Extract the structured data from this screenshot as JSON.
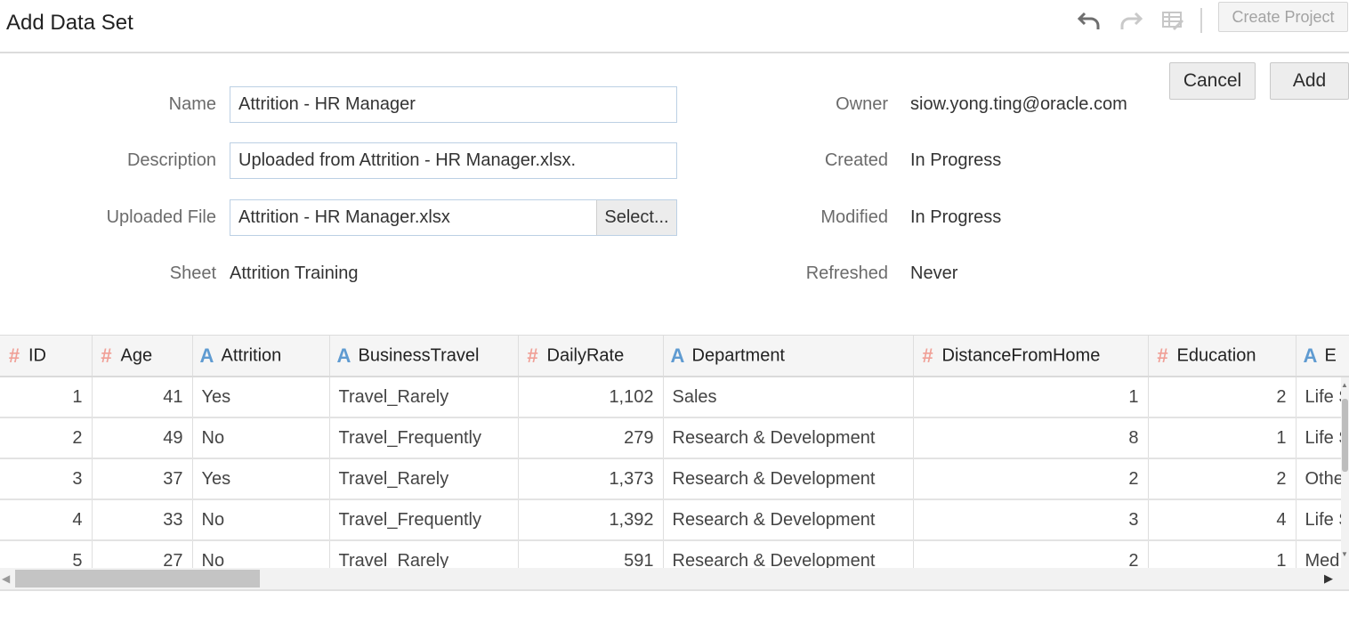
{
  "header": {
    "title": "Add Data Set",
    "create_project_label": "Create Project",
    "icons": [
      "undo-icon",
      "redo-icon",
      "data-diagram-icon"
    ]
  },
  "actions": {
    "cancel_label": "Cancel",
    "add_label": "Add"
  },
  "form": {
    "name_label": "Name",
    "name_value": "Attrition - HR Manager",
    "description_label": "Description",
    "description_value": "Uploaded from Attrition - HR Manager.xlsx.",
    "uploaded_file_label": "Uploaded File",
    "uploaded_file_value": "Attrition - HR Manager.xlsx",
    "select_label": "Select...",
    "sheet_label": "Sheet",
    "sheet_value": "Attrition Training"
  },
  "meta": {
    "owner_label": "Owner",
    "owner_value": "siow.yong.ting@oracle.com",
    "created_label": "Created",
    "created_value": "In Progress",
    "modified_label": "Modified",
    "modified_value": "In Progress",
    "refreshed_label": "Refreshed",
    "refreshed_value": "Never"
  },
  "grid": {
    "columns": [
      {
        "label": "ID",
        "type": "number",
        "icon": "#"
      },
      {
        "label": "Age",
        "type": "number",
        "icon": "#"
      },
      {
        "label": "Attrition",
        "type": "text",
        "icon": "A"
      },
      {
        "label": "BusinessTravel",
        "type": "text",
        "icon": "A"
      },
      {
        "label": "DailyRate",
        "type": "number",
        "icon": "#"
      },
      {
        "label": "Department",
        "type": "text",
        "icon": "A"
      },
      {
        "label": "DistanceFromHome",
        "type": "number",
        "icon": "#"
      },
      {
        "label": "Education",
        "type": "number",
        "icon": "#"
      },
      {
        "label": "E",
        "type": "text",
        "icon": "A"
      }
    ],
    "rows": [
      [
        "1",
        "41",
        "Yes",
        "Travel_Rarely",
        "1,102",
        "Sales",
        "1",
        "2",
        "Life S"
      ],
      [
        "2",
        "49",
        "No",
        "Travel_Frequently",
        "279",
        "Research & Development",
        "8",
        "1",
        "Life S"
      ],
      [
        "3",
        "37",
        "Yes",
        "Travel_Rarely",
        "1,373",
        "Research & Development",
        "2",
        "2",
        "Other"
      ],
      [
        "4",
        "33",
        "No",
        "Travel_Frequently",
        "1,392",
        "Research & Development",
        "3",
        "4",
        "Life S"
      ],
      [
        "5",
        "27",
        "No",
        "Travel_Rarely",
        "591",
        "Research & Development",
        "2",
        "1",
        "Med"
      ]
    ]
  },
  "scrollbars": {
    "horizontal_position": 0.0
  }
}
